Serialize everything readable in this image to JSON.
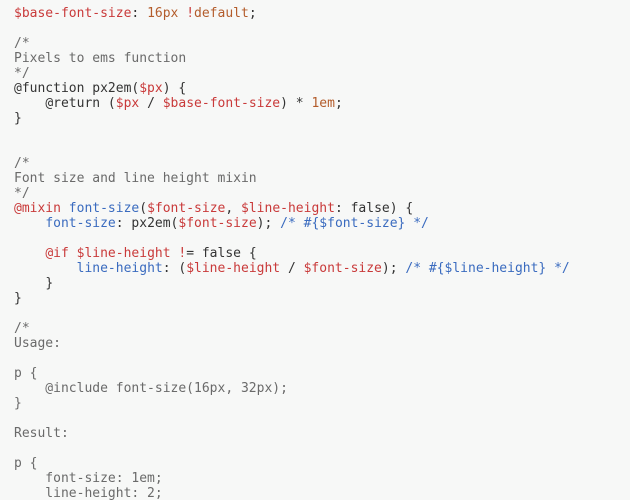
{
  "tok": {
    "base_var": "$base-font-size",
    "colon": ":",
    "sp": " ",
    "val16": "16px",
    "bang": "!",
    "default": "default",
    "semi": ";",
    "cmt_open": "/*",
    "cmt_px2em": "Pixels to ems function",
    "cmt_close": "*/",
    "fn_decl": "@function px2em(",
    "px_var": "$px",
    "fn_close": ") {",
    "indent": "    ",
    "return_open": "@return (",
    "slash": " / ",
    "return_close": ") * ",
    "one_em": "1em",
    "rbrace": "}",
    "cmt_mixin": "Font size and line height mixin",
    "at_mixin": "@mixin",
    "mixin_name": "font-size",
    "lparen": "(",
    "fs_var": "$font-size",
    "comma": ", ",
    "lh_var": "$line-height",
    "false_tail": ": false) {",
    "prop_fs": "font-size",
    "px2em_call": ": px2em(",
    "rparen_semi": "); ",
    "cmt_fs": "/* #{$font-size} */",
    "at_if": "@if",
    "neq_false": "= false {",
    "neq_bang": " !",
    "prop_lh": "line-height",
    "lh_open": ": (",
    "cmt_lh": "/* #{$line-height} */",
    "indent2": "        ",
    "cmt_usage": "Usage:",
    "p_open": "p {",
    "include": "    @include font-size(16px, 32px);",
    "cmt_result": "Result:",
    "res_fs": "    font-size: 1em;",
    "res_lh": "    line-height: 2;"
  }
}
